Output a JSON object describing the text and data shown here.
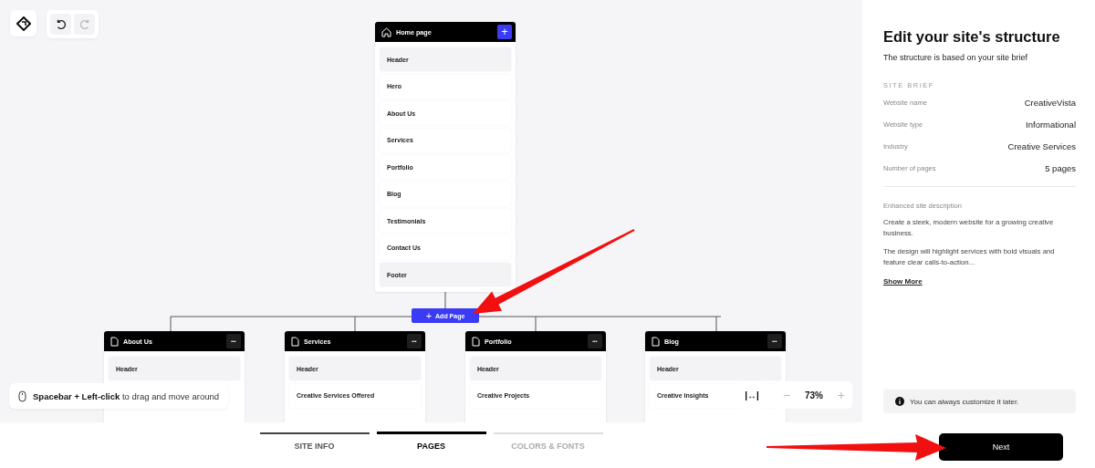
{
  "toolbar": {
    "buttons": [
      {
        "kind": "undo",
        "disabled": false
      },
      {
        "kind": "redo",
        "disabled": true
      }
    ]
  },
  "home_page": {
    "title": "Home page",
    "sections": [
      {
        "label": "Header",
        "kind": "fixed"
      },
      {
        "label": "Hero",
        "kind": "section"
      },
      {
        "label": "About Us",
        "kind": "section"
      },
      {
        "label": "Services",
        "kind": "section"
      },
      {
        "label": "Portfolio",
        "kind": "section"
      },
      {
        "label": "Blog",
        "kind": "section"
      },
      {
        "label": "Testimonials",
        "kind": "section"
      },
      {
        "label": "Contact Us",
        "kind": "section"
      },
      {
        "label": "Footer",
        "kind": "fixed"
      }
    ]
  },
  "add_page_button": {
    "label": "Add Page",
    "icon": "+"
  },
  "pages": [
    {
      "title": "About Us",
      "menu": "•••",
      "sections": [
        {
          "label": "Header",
          "kind": "fixed"
        }
      ]
    },
    {
      "title": "Services",
      "menu": "•••",
      "sections": [
        {
          "label": "Header",
          "kind": "fixed"
        },
        {
          "label": "Creative Services Offered",
          "kind": "section"
        }
      ]
    },
    {
      "title": "Portfolio",
      "menu": "•••",
      "sections": [
        {
          "label": "Header",
          "kind": "fixed"
        },
        {
          "label": "Creative Projects",
          "kind": "section"
        }
      ]
    },
    {
      "title": "Blog",
      "menu": "•••",
      "sections": [
        {
          "label": "Header",
          "kind": "fixed"
        },
        {
          "label": "Creative Insights",
          "kind": "section"
        }
      ]
    }
  ],
  "hint": {
    "text": "**Spacebar + Left-click** to drag and move around"
  },
  "zoom": {
    "fit": "|↔|",
    "minus": "−",
    "value": "73%",
    "plus": "+"
  },
  "steps": [
    {
      "label": "SITE INFO",
      "selected": false,
      "completed": true
    },
    {
      "label": "PAGES",
      "selected": true,
      "completed": false
    },
    {
      "label": "COLORS & FONTS",
      "selected": false,
      "completed": false
    }
  ],
  "panel": {
    "title": "Edit your site's structure",
    "subtitle": "The structure is based on your site brief",
    "section_label": "SITE BRIEF",
    "brief": [
      {
        "label": "Website name",
        "value": "CreativeVista"
      },
      {
        "label": "Website type",
        "value": "Informational"
      },
      {
        "label": "Industry",
        "value": "Creative Services"
      },
      {
        "label": "Number of pages",
        "value": "5 pages"
      }
    ],
    "description_label": "Enhanced site description",
    "description": [
      "Create a sleek, modern website for a growing creative business.",
      " The design will highlight services with bold visuals and feature clear calls-to-action..."
    ],
    "show_more": "Show More",
    "note": "You can always customize it later.",
    "next_button": "Next"
  }
}
